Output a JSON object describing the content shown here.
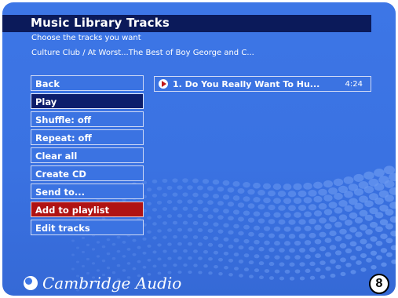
{
  "header": {
    "title": "Music Library Tracks",
    "subtitle": "Choose the tracks you want",
    "context": "Culture Club / At Worst...The Best of Boy George and C..."
  },
  "menu": {
    "items": [
      {
        "label": "Back"
      },
      {
        "label": "Play"
      },
      {
        "label": "Shuffle: off"
      },
      {
        "label": "Repeat: off"
      },
      {
        "label": "Clear all"
      },
      {
        "label": "Create CD"
      },
      {
        "label": "Send to..."
      },
      {
        "label": "Add to playlist"
      },
      {
        "label": "Edit tracks"
      }
    ]
  },
  "tracks": [
    {
      "title": "1. Do You Really Want To Hu...",
      "time": "4:24",
      "icon": "play-icon"
    }
  ],
  "brand": {
    "name": "Cambridge Audio"
  },
  "page_number": "8",
  "colors": {
    "background": "#3d76e6",
    "title_bar": "#0b1a5a",
    "selected": "#0c1d6b",
    "highlight": "#b01313"
  }
}
